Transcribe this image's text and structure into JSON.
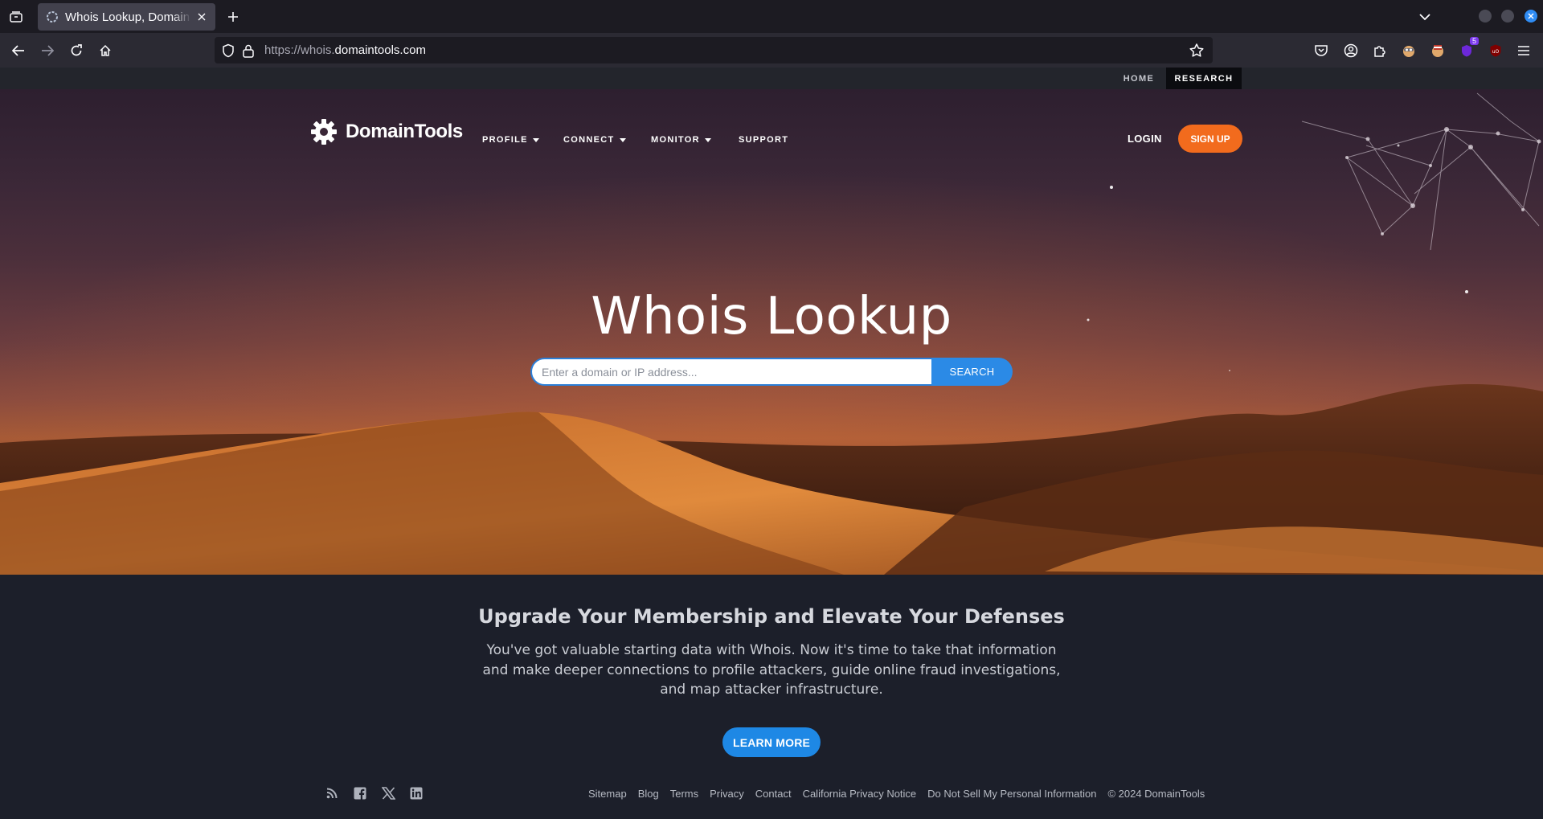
{
  "browser": {
    "tab_title": "Whois Lookup, Domain Availability & IP Search",
    "url_prefix": "https://whois.",
    "url_domain": "domaintools.com",
    "extension_badge": "5"
  },
  "utility_nav": {
    "home": "HOME",
    "research": "RESEARCH"
  },
  "site_nav": {
    "logo_text": "DomainTools",
    "menu": [
      "PROFILE",
      "CONNECT",
      "MONITOR",
      "SUPPORT"
    ],
    "login": "LOGIN",
    "signup": "SIGN UP"
  },
  "hero": {
    "title": "Whois Lookup",
    "search_placeholder": "Enter a domain or IP address...",
    "search_button": "SEARCH"
  },
  "promo": {
    "title": "Upgrade Your Membership and Elevate Your Defenses",
    "body": "You've got valuable starting data with Whois. Now it's time to take that information and make deeper connections to profile attackers, guide online fraud investigations, and map attacker infrastructure.",
    "cta": "LEARN MORE"
  },
  "footer": {
    "social_icons": [
      "rss-icon",
      "facebook-icon",
      "x-icon",
      "linkedin-icon"
    ],
    "links": [
      "Sitemap",
      "Blog",
      "Terms",
      "Privacy",
      "Contact",
      "California Privacy Notice",
      "Do Not Sell My Personal Information"
    ],
    "copyright": "© 2024 DomainTools"
  },
  "colors": {
    "accent_orange": "#f26b1d",
    "accent_blue": "#1e88e5",
    "footer_bg": "#1c1f2a"
  }
}
